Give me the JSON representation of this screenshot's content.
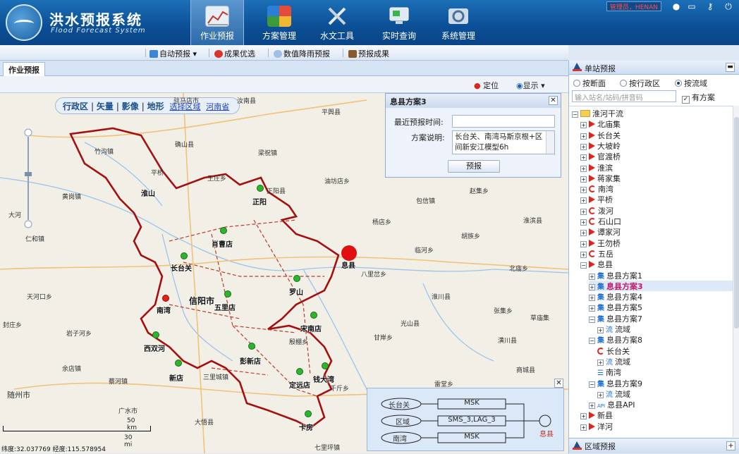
{
  "header": {
    "title": "洪水预报系统",
    "subtitle": "Flood Forecast System",
    "user": "管理员，HENAN",
    "nav": [
      {
        "label": "作业预报",
        "icon": "chart-icon",
        "active": true
      },
      {
        "label": "方案管理",
        "icon": "puzzle-icon",
        "active": false
      },
      {
        "label": "水文工具",
        "icon": "tools-icon",
        "active": false
      },
      {
        "label": "实时查询",
        "icon": "monitor-icon",
        "active": false
      },
      {
        "label": "系统管理",
        "icon": "gear-icon",
        "active": false
      }
    ]
  },
  "toolbar": {
    "auto_forecast": "自动预报",
    "result_select": "成果优选",
    "numeric_rain": "数值降雨预报",
    "forecast_results": "预报成果"
  },
  "tabs": {
    "active": "作业预报"
  },
  "maptools": {
    "locate": "定位",
    "display": "显示"
  },
  "layer_switch": {
    "admin": "行政区",
    "vector": "矢量",
    "image": "影像",
    "terrain": "地形",
    "select_area": "选择区域",
    "province": "河南省"
  },
  "popup": {
    "title": "息县方案3",
    "time_label": "最近预报时间:",
    "time_value": "",
    "desc_label": "方案说明:",
    "desc_value": "长台关、南湾马斯京根+区间新安江模型6h",
    "button": "预报"
  },
  "map": {
    "sites": [
      {
        "name": "正阳"
      },
      {
        "name": "肖曹店"
      },
      {
        "name": "长台关"
      },
      {
        "name": "罗山"
      },
      {
        "name": "五里店"
      },
      {
        "name": "南湾"
      },
      {
        "name": "信阳市"
      },
      {
        "name": "西双河"
      },
      {
        "name": "新店"
      },
      {
        "name": "彭新店"
      },
      {
        "name": "宋南店"
      },
      {
        "name": "定远店"
      },
      {
        "name": "钱大湾"
      },
      {
        "name": "卡房"
      },
      {
        "name": "息县"
      },
      {
        "name": "淮山"
      }
    ],
    "places": [
      "驻马店市",
      "平舆县",
      "汝南县",
      "确山县",
      "竹沟镇",
      "梁祝镇",
      "王庄乡",
      "正阳县",
      "油坊店乡",
      "赵集乡",
      "包信镇",
      "杨店乡",
      "淮滨县",
      "临河乡",
      "八里岔乡",
      "北庙乡",
      "淮川县",
      "张集乡",
      "草庙集",
      "光山县",
      "商城县",
      "雷堂乡",
      "胡族乡",
      "潢川县",
      "天河口乡",
      "黄岗镇",
      "大河",
      "平桥",
      "岩子河乡",
      "余店镇",
      "蔡河镇",
      "随州市",
      "广水市",
      "大悟县",
      "三里城镇",
      "千斤乡",
      "殷棚乡",
      "七里坪镇",
      "封庄乡",
      "甘岸乡",
      "仁和镇"
    ],
    "scale_km": "50 km",
    "scale_mi": "30 mi",
    "coords": "纬度:32.037769  经度:115.578954"
  },
  "diagram": {
    "nodes": [
      "长台关",
      "区域",
      "南湾"
    ],
    "models": [
      "MSK",
      "SMS_3,LAG_3",
      "MSK"
    ],
    "output": "息县"
  },
  "rpanel": {
    "title": "单站预报",
    "radios": [
      "按断面",
      "按行政区",
      "按流域"
    ],
    "radio_selected": 2,
    "search_placeholder": "输入站名/站码/拼音码",
    "has_plan": "有方案",
    "tree": [
      {
        "label": "淮河干流",
        "type": "folder",
        "level": 0,
        "exp": "-"
      },
      {
        "label": "北庙集",
        "type": "flag",
        "level": 1,
        "exp": "+"
      },
      {
        "label": "长台关",
        "type": "flag",
        "level": 1,
        "exp": "+"
      },
      {
        "label": "大坡岭",
        "type": "flag",
        "level": 1,
        "exp": "+"
      },
      {
        "label": "官渡桥",
        "type": "flag",
        "level": 1,
        "exp": "+"
      },
      {
        "label": "淮滨",
        "type": "flag",
        "level": 1,
        "exp": "+"
      },
      {
        "label": "蒋家集",
        "type": "flag",
        "level": 1,
        "exp": "+"
      },
      {
        "label": "南湾",
        "type": "half",
        "level": 1,
        "exp": "+"
      },
      {
        "label": "平桥",
        "type": "flag",
        "level": 1,
        "exp": "+"
      },
      {
        "label": "泼河",
        "type": "half",
        "level": 1,
        "exp": "+"
      },
      {
        "label": "石山口",
        "type": "half",
        "level": 1,
        "exp": "+"
      },
      {
        "label": "谭家河",
        "type": "flag",
        "level": 1,
        "exp": "+"
      },
      {
        "label": "王勿桥",
        "type": "flag",
        "level": 1,
        "exp": "+"
      },
      {
        "label": "五岳",
        "type": "half",
        "level": 1,
        "exp": "+"
      },
      {
        "label": "息县",
        "type": "flag",
        "level": 1,
        "exp": "-"
      },
      {
        "label": "息县方案1",
        "type": "ji",
        "level": 2,
        "exp": "+"
      },
      {
        "label": "息县方案3",
        "type": "ji",
        "level": 2,
        "exp": "+",
        "selected": true
      },
      {
        "label": "息县方案4",
        "type": "ji",
        "level": 2,
        "exp": "+"
      },
      {
        "label": "息县方案5",
        "type": "ji",
        "level": 2,
        "exp": "+"
      },
      {
        "label": "息县方案7",
        "type": "ji",
        "level": 2,
        "exp": "-"
      },
      {
        "label": "流域",
        "type": "liu",
        "level": 3,
        "exp": "+"
      },
      {
        "label": "息县方案8",
        "type": "ji",
        "level": 2,
        "exp": "-"
      },
      {
        "label": "长台关",
        "type": "half",
        "level": 3,
        "exp": ""
      },
      {
        "label": "流域",
        "type": "liu",
        "level": 3,
        "exp": "+"
      },
      {
        "label": "南湾",
        "type": "doc",
        "level": 3,
        "exp": ""
      },
      {
        "label": "息县方案9",
        "type": "ji",
        "level": 2,
        "exp": "-"
      },
      {
        "label": "流域",
        "type": "liu",
        "level": 3,
        "exp": "+"
      },
      {
        "label": "息县API",
        "type": "api",
        "level": 2,
        "exp": "+"
      },
      {
        "label": "新县",
        "type": "flag",
        "level": 1,
        "exp": "+"
      },
      {
        "label": "洋河",
        "type": "flag",
        "level": 1,
        "exp": "+"
      }
    ],
    "bottom": "区域预报"
  }
}
